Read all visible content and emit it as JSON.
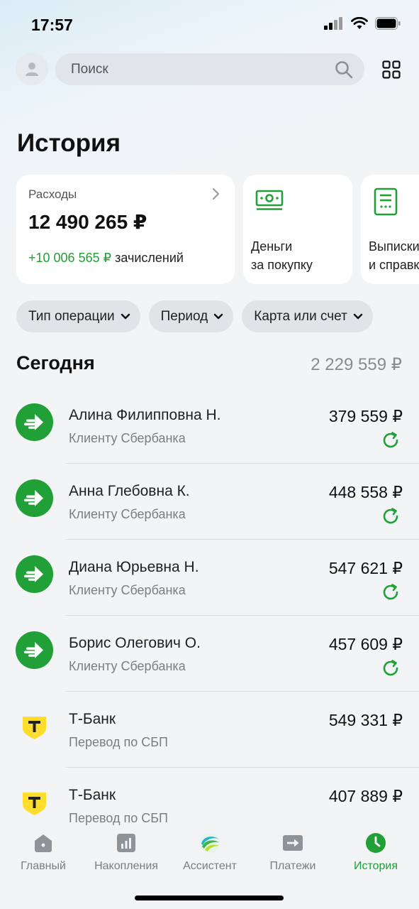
{
  "status_bar": {
    "time": "17:57"
  },
  "search": {
    "placeholder": "Поиск"
  },
  "page": {
    "title": "История"
  },
  "expenses_card": {
    "label": "Расходы",
    "amount": "12 490 265 ₽",
    "income_amount": "+10 006 565 ₽",
    "income_label": "зачислений"
  },
  "cashback_card": {
    "title": "Деньги\nза покупку"
  },
  "statements_card": {
    "title": "Выписки\nи справки"
  },
  "filters": [
    {
      "label": "Тип операции"
    },
    {
      "label": "Период"
    },
    {
      "label": "Карта или счет"
    }
  ],
  "section": {
    "title": "Сегодня",
    "total": "2 229 559 ₽"
  },
  "transactions": [
    {
      "name": "Алина Филипповна Н.",
      "subtitle": "Клиенту Сбербанка",
      "amount": "379 559 ₽",
      "icon": "sber-transfer-icon",
      "repeat": true
    },
    {
      "name": "Анна Глебовна К.",
      "subtitle": "Клиенту Сбербанка",
      "amount": "448 558 ₽",
      "icon": "sber-transfer-icon",
      "repeat": true
    },
    {
      "name": "Диана Юрьевна Н.",
      "subtitle": "Клиенту Сбербанка",
      "amount": "547 621 ₽",
      "icon": "sber-transfer-icon",
      "repeat": true
    },
    {
      "name": "Борис Олегович О.",
      "subtitle": "Клиенту Сбербанка",
      "amount": "457 609 ₽",
      "icon": "sber-transfer-icon",
      "repeat": true
    },
    {
      "name": "Т-Банк",
      "subtitle": "Перевод по СБП",
      "amount": "549 331 ₽",
      "icon": "tbank-logo-icon",
      "repeat": false
    },
    {
      "name": "Т-Банк",
      "subtitle": "Перевод по СБП",
      "amount": "407 889 ₽",
      "icon": "tbank-logo-icon",
      "repeat": false
    }
  ],
  "bottom_nav": [
    {
      "label": "Главный",
      "icon": "home-icon",
      "active": false
    },
    {
      "label": "Накопления",
      "icon": "savings-chart-icon",
      "active": false
    },
    {
      "label": "Ассистент",
      "icon": "assistant-icon",
      "active": false
    },
    {
      "label": "Платежи",
      "icon": "payments-arrow-icon",
      "active": false
    },
    {
      "label": "История",
      "icon": "history-clock-icon",
      "active": true
    }
  ],
  "colors": {
    "accent_green": "#21a038",
    "tbank_yellow": "#ffdd2d",
    "muted_text": "#7d7d7d"
  }
}
